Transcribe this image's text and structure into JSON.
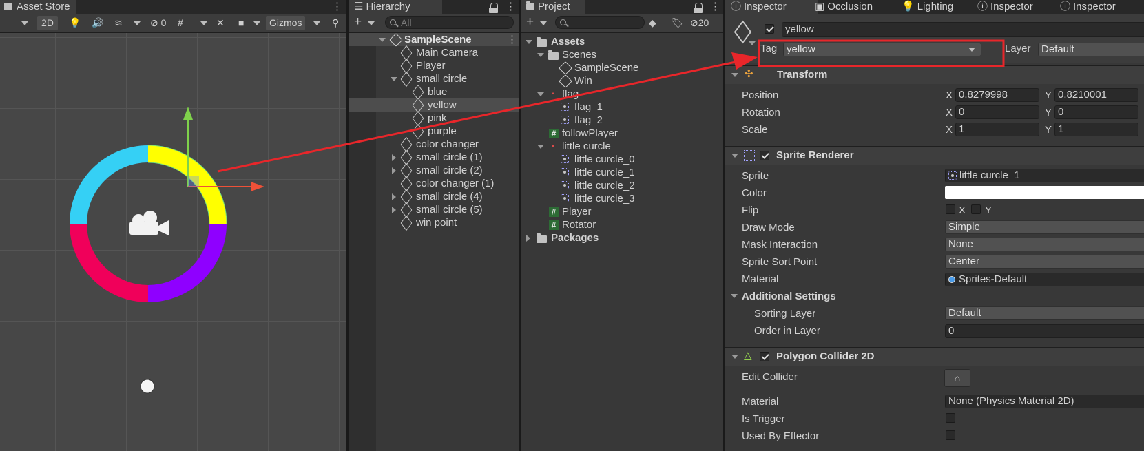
{
  "scene_panel": {
    "tab": "Asset Store",
    "btn_2d": "2D",
    "hidden_count": "0",
    "gizmos": "Gizmos"
  },
  "hierarchy": {
    "tab": "Hierarchy",
    "search_placeholder": "All",
    "scene_name": "SampleScene",
    "items": [
      {
        "label": "Main Camera"
      },
      {
        "label": "Player"
      },
      {
        "label": "small circle"
      },
      {
        "label": "blue"
      },
      {
        "label": "yellow"
      },
      {
        "label": "pink"
      },
      {
        "label": "purple"
      },
      {
        "label": "color changer"
      },
      {
        "label": "small circle (1)"
      },
      {
        "label": "small circle (2)"
      },
      {
        "label": "color changer (1)"
      },
      {
        "label": "small circle (4)"
      },
      {
        "label": "small circle (5)"
      },
      {
        "label": "win point"
      }
    ]
  },
  "project": {
    "tab": "Project",
    "hidden_count": "20",
    "items": [
      {
        "label": "Assets"
      },
      {
        "label": "Scenes"
      },
      {
        "label": "SampleScene"
      },
      {
        "label": "Win"
      },
      {
        "label": "flag"
      },
      {
        "label": "flag_1"
      },
      {
        "label": "flag_2"
      },
      {
        "label": "followPlayer"
      },
      {
        "label": "little curcle"
      },
      {
        "label": "little curcle_0"
      },
      {
        "label": "little curcle_1"
      },
      {
        "label": "little curcle_2"
      },
      {
        "label": "little curcle_3"
      },
      {
        "label": "Player"
      },
      {
        "label": "Rotator"
      },
      {
        "label": "Packages"
      }
    ]
  },
  "inspector": {
    "tabs": [
      {
        "label": "Inspector"
      },
      {
        "label": "Occlusion"
      },
      {
        "label": "Lighting"
      },
      {
        "label": "Inspector"
      },
      {
        "label": "Inspector"
      }
    ],
    "object_name": "yellow",
    "tag_label": "Tag",
    "tag_value": "yellow",
    "layer_label": "Layer",
    "layer_value": "Default",
    "transform": {
      "title": "Transform",
      "position_label": "Position",
      "rotation_label": "Rotation",
      "scale_label": "Scale",
      "x_axis": "X",
      "y_axis": "Y",
      "position_x": "0.8279998",
      "position_y": "0.8210001",
      "rotation_x": "0",
      "rotation_y": "0",
      "scale_x": "1",
      "scale_y": "1"
    },
    "sprite_renderer": {
      "title": "Sprite Renderer",
      "sprite_label": "Sprite",
      "sprite_value": "little curcle_1",
      "color_label": "Color",
      "color_value": "#ffffff",
      "flip_label": "Flip",
      "flip_x": "X",
      "flip_y": "Y",
      "draw_mode_label": "Draw Mode",
      "draw_mode_value": "Simple",
      "mask_label": "Mask Interaction",
      "mask_value": "None",
      "sort_point_label": "Sprite Sort Point",
      "sort_point_value": "Center",
      "material_label": "Material",
      "material_value": "Sprites-Default",
      "additional_settings": "Additional Settings",
      "sorting_layer_label": "Sorting Layer",
      "sorting_layer_value": "Default",
      "order_label": "Order in Layer",
      "order_value": "0"
    },
    "polygon_collider": {
      "title": "Polygon Collider 2D",
      "edit_collider_label": "Edit Collider",
      "material_label": "Material",
      "material_value": "None (Physics Material 2D)",
      "is_trigger_label": "Is Trigger",
      "used_by_effector_label": "Used By Effector"
    }
  },
  "colors": {
    "annotation_red": "#e8262a",
    "ring_yellow": "#ffff00",
    "ring_cyan": "#35d0f5",
    "ring_magenta": "#f0005a",
    "ring_purple": "#8f00ff"
  }
}
